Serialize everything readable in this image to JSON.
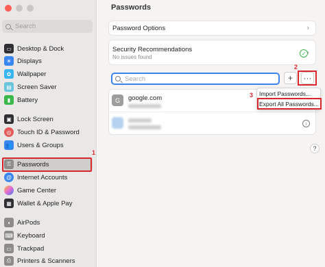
{
  "sidebar": {
    "search_placeholder": "Search",
    "items": [
      {
        "label": "Desktop & Dock",
        "icon": "desktop-dock-icon",
        "color": "#2f2f33"
      },
      {
        "label": "Displays",
        "icon": "displays-icon",
        "color": "#3a86f0"
      },
      {
        "label": "Wallpaper",
        "icon": "wallpaper-icon",
        "color": "#39b6f0"
      },
      {
        "label": "Screen Saver",
        "icon": "screen-saver-icon",
        "color": "#6ac5dc"
      },
      {
        "label": "Battery",
        "icon": "battery-icon",
        "color": "#3bb84a"
      },
      {
        "label": "Lock Screen",
        "icon": "lock-screen-icon",
        "color": "#2f2f33"
      },
      {
        "label": "Touch ID & Password",
        "icon": "fingerprint-icon",
        "color": "#e55a5a"
      },
      {
        "label": "Users & Groups",
        "icon": "users-icon",
        "color": "#3a86f0"
      },
      {
        "label": "Passwords",
        "icon": "key-icon",
        "color": "#8d8c8b"
      },
      {
        "label": "Internet Accounts",
        "icon": "at-icon",
        "color": "#3a86f0"
      },
      {
        "label": "Game Center",
        "icon": "game-center-icon",
        "color": "#e86ad3"
      },
      {
        "label": "Wallet & Apple Pay",
        "icon": "wallet-icon",
        "color": "#2f2f33"
      },
      {
        "label": "AirPods",
        "icon": "airpods-icon",
        "color": "#8d8c8b"
      },
      {
        "label": "Keyboard",
        "icon": "keyboard-icon",
        "color": "#8d8c8b"
      },
      {
        "label": "Trackpad",
        "icon": "trackpad-icon",
        "color": "#8d8c8b"
      },
      {
        "label": "Printers & Scanners",
        "icon": "printer-icon",
        "color": "#8d8c8b"
      }
    ]
  },
  "main": {
    "title": "Passwords",
    "password_options": "Password Options",
    "security_title": "Security Recommendations",
    "security_subtitle": "No issues found",
    "search_placeholder": "Search",
    "add_glyph": "+",
    "more_glyph": "···",
    "entries": [
      {
        "initial": "G",
        "site": "google.com"
      }
    ],
    "info_glyph": "i",
    "help_glyph": "?"
  },
  "menu": {
    "import": "Import Passwords...",
    "export": "Export All Passwords..."
  },
  "annotations": {
    "one": "1",
    "two": "2",
    "three": "3",
    "color": "#d9262c"
  }
}
